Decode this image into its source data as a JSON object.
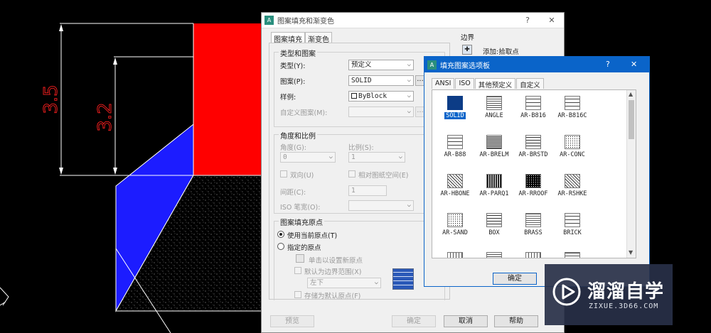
{
  "drawing": {
    "dimension_outer": "3.5",
    "dimension_inner": "3.2",
    "colors": {
      "red": "#ff0000",
      "blue": "#1c1cff",
      "line": "#ffffff",
      "dim_text": "#ff2020"
    }
  },
  "hatch_dialog": {
    "title": "图案填充和渐变色",
    "help_button": "?",
    "close_button": "✕",
    "tabs": [
      "图案填充",
      "渐变色"
    ],
    "type_pattern": {
      "title": "类型和图案",
      "type_label": "类型(Y):",
      "type_value": "预定义",
      "pattern_label": "图案(P):",
      "pattern_value": "SOLID",
      "sample_label": "样例:",
      "sample_value": "ByBlock",
      "custom_label": "自定义图案(M):",
      "custom_value": "",
      "ellipsis": "..."
    },
    "angle_scale": {
      "title": "角度和比例",
      "angle_label": "角度(G):",
      "angle_value": "0",
      "scale_label": "比例(S):",
      "scale_value": "1",
      "double_label": "双向(U)",
      "paper_label": "相对图纸空间(E)",
      "spacing_label": "间距(C):",
      "spacing_value": "1",
      "iso_label": "ISO 笔宽(O):"
    },
    "origin": {
      "title": "图案填充原点",
      "use_current": "使用当前原点(T)",
      "specified": "指定的原点",
      "click_set": "单击以设置新原点",
      "default_boundary": "默认为边界范围(X)",
      "position_value": "左下",
      "store_default": "存储为默认原点(F)"
    },
    "boundary": {
      "title": "边界",
      "add_pick": "添加:拾取点"
    },
    "buttons": {
      "preview": "预览",
      "ok": "确定",
      "cancel": "取消",
      "help": "帮助"
    }
  },
  "palette_dialog": {
    "title": "填充图案选项板",
    "help_button": "?",
    "close_button": "✕",
    "tabs": [
      "ANSI",
      "ISO",
      "其他预定义",
      "自定义"
    ],
    "active_tab": "其他预定义",
    "patterns": [
      {
        "name": "SOLID",
        "icon": "solid-swatch",
        "selected": true
      },
      {
        "name": "ANGLE",
        "icon": "angle-swatch"
      },
      {
        "name": "AR-B816",
        "icon": "brick-swatch"
      },
      {
        "name": "AR-B816C",
        "icon": "brick-swatch"
      },
      {
        "name": "AR-B88",
        "icon": "brick-swatch"
      },
      {
        "name": "AR-BRELM",
        "icon": "dense-brick-swatch"
      },
      {
        "name": "AR-BRSTD",
        "icon": "brick-swatch"
      },
      {
        "name": "AR-CONC",
        "icon": "concrete-swatch"
      },
      {
        "name": "AR-HBONE",
        "icon": "herringbone-swatch"
      },
      {
        "name": "AR-PARQ1",
        "icon": "parquet-swatch"
      },
      {
        "name": "AR-RROOF",
        "icon": "roof-swatch"
      },
      {
        "name": "AR-RSHKE",
        "icon": "shake-swatch"
      },
      {
        "name": "AR-SAND",
        "icon": "sand-swatch"
      },
      {
        "name": "BOX",
        "icon": "box-swatch"
      },
      {
        "name": "BRASS",
        "icon": "brass-swatch"
      },
      {
        "name": "BRICK",
        "icon": "brick-swatch"
      }
    ],
    "ok_button": "确定"
  },
  "watermark": {
    "brand": "溜溜自学",
    "url": "ZIXUE.3D66.COM"
  }
}
